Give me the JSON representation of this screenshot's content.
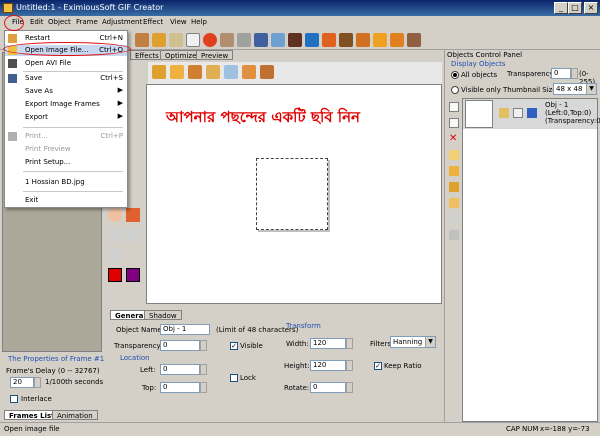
{
  "window": {
    "title": "Untitled:1 - EximiousSoft GIF Creator"
  },
  "menubar": [
    "File",
    "Edit",
    "Object",
    "Frame",
    "Adjustment",
    "Effect",
    "View",
    "Help"
  ],
  "file_menu": {
    "items": [
      {
        "label": "Restart",
        "shortcut": "Ctrl+N"
      },
      {
        "label": "Open Image File...",
        "shortcut": "Ctrl+O"
      },
      {
        "label": "Open AVI File",
        "shortcut": ""
      },
      {
        "label": "Save",
        "shortcut": "Ctrl+S"
      },
      {
        "label": "Save As",
        "shortcut": ""
      },
      {
        "label": "Export Image Frames",
        "shortcut": ""
      },
      {
        "label": "Export",
        "shortcut": ""
      },
      {
        "label": "Print...",
        "shortcut": "Ctrl+P"
      },
      {
        "label": "Print Preview",
        "shortcut": ""
      },
      {
        "label": "Print Setup...",
        "shortcut": ""
      },
      {
        "label": "1 Hossian BD.jpg",
        "shortcut": ""
      },
      {
        "label": "Exit",
        "shortcut": ""
      }
    ]
  },
  "inner_tabs": [
    "Effects",
    "Optimize",
    "Preview"
  ],
  "canvas": {
    "headline": "আপনার পছন্দের একটি ছবি নিন"
  },
  "properties": {
    "tabs": [
      "General",
      "Shadow"
    ],
    "object_name_label": "Object Name:",
    "object_name_value": "Obj - 1",
    "object_name_limit": "(Limit of 48 characters)",
    "transparency_label": "Transparency:",
    "transparency_value": "0",
    "visible_label": "Visible",
    "location_label": "Location",
    "left_label": "Left:",
    "left_value": "0",
    "top_label": "Top:",
    "top_value": "0",
    "lock_label": "Lock",
    "transform_label": "Transform",
    "width_label": "Width:",
    "width_value": "120",
    "height_label": "Height:",
    "height_value": "120",
    "rotate_label": "Rotate:",
    "rotate_value": "0",
    "filters_label": "Filters:",
    "filters_value": "Hanning",
    "keep_ratio_label": "Keep Ratio"
  },
  "frame_panel": {
    "props_title": "The Properties of Frame #1",
    "delay_label": "Frame's Delay (0 -- 32767)",
    "delay_value": "20",
    "delay_unit": "1/100th seconds",
    "interlace_label": "Interlace",
    "tabs": [
      "Frames List",
      "Animation"
    ]
  },
  "objects_panel": {
    "title": "Objects Control Panel",
    "display_label": "Display Objects",
    "all_objects": "All objects",
    "visible_only": "Visible only",
    "transparency_label": "Transparency:",
    "transparency_value": "0",
    "transparency_range": "(0-255)",
    "thumb_label": "Thumbnail Size:",
    "thumb_value": "48 x 48",
    "item": {
      "name": "Obj - 1",
      "pos": "(Left:0,Top:0)",
      "trans": "(Transparency:0)"
    }
  },
  "status": {
    "text": "Open image file",
    "caps": "CAP",
    "num": "NUM",
    "coords": "x=-188 y=-73"
  },
  "colors": {
    "accent": "#0a246a",
    "headline": "#e00000",
    "highlight_circle": "#e01010"
  }
}
